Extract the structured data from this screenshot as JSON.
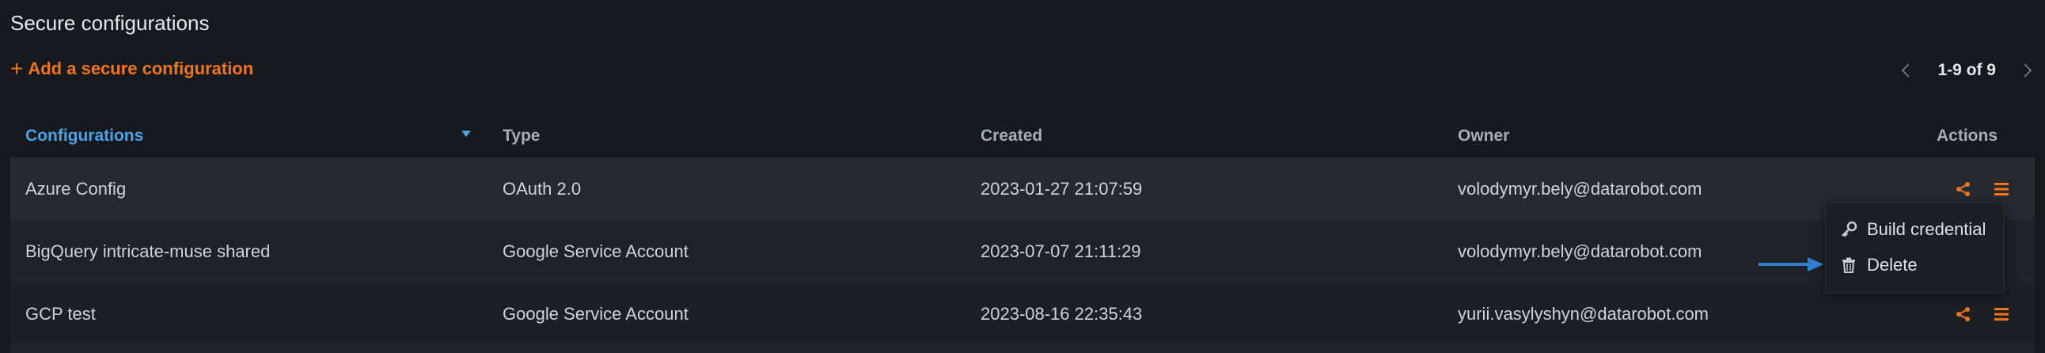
{
  "page": {
    "title": "Secure configurations"
  },
  "toolbar": {
    "add_label": "Add a secure configuration",
    "add_icon": "plus-icon"
  },
  "pager": {
    "range": "1-9 of 9"
  },
  "table": {
    "columns": [
      "Configurations",
      "Type",
      "Created",
      "Owner",
      "Actions"
    ],
    "sort_column": "Configurations",
    "rows": [
      {
        "name": "Azure Config",
        "type": "OAuth 2.0",
        "created": "2023-01-27 21:07:59",
        "owner": "volodymyr.bely@datarobot.com"
      },
      {
        "name": "BigQuery intricate-muse shared",
        "type": "Google Service Account",
        "created": "2023-07-07 21:11:29",
        "owner": "volodymyr.bely@datarobot.com"
      },
      {
        "name": "GCP test",
        "type": "Google Service Account",
        "created": "2023-08-16 22:35:43",
        "owner": "yurii.vasylyshyn@datarobot.com"
      }
    ]
  },
  "menu": {
    "items": [
      {
        "label": "Build credential",
        "icon": "key-icon"
      },
      {
        "label": "Delete",
        "icon": "trash-icon"
      }
    ]
  },
  "colors": {
    "accent": "#f2751a",
    "link_blue": "#4aa3e8",
    "annotation_arrow": "#2f7fd0",
    "background": "#16191d"
  }
}
